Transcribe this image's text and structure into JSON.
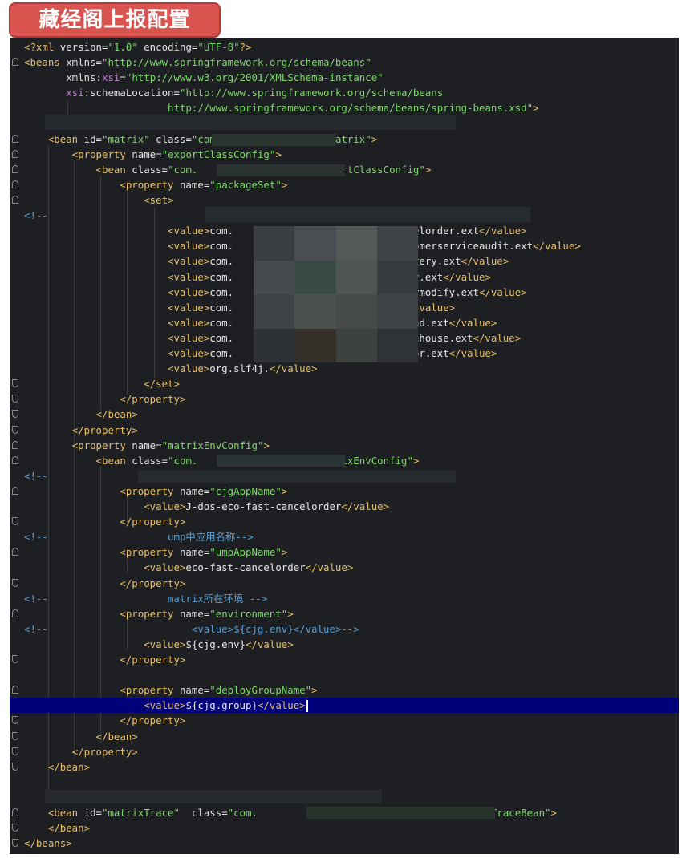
{
  "title": "藏经阁上报配置",
  "lines": [
    {
      "n": 1,
      "indent": "",
      "parts": [
        [
          "t",
          "<?xml "
        ],
        [
          "a",
          "version"
        ],
        [
          "v",
          "="
        ],
        [
          "s",
          "\"1.0\""
        ],
        [
          "a",
          " encoding"
        ],
        [
          "v",
          "="
        ],
        [
          "s",
          "\"UTF-8\""
        ],
        [
          "t",
          "?>"
        ]
      ]
    },
    {
      "n": 2,
      "parts": [
        [
          "t",
          "<beans "
        ],
        [
          "a",
          "xmlns"
        ],
        [
          "v",
          "="
        ],
        [
          "s",
          "\"http://www.springframework.org/schema/beans\""
        ]
      ]
    },
    {
      "n": 3,
      "parts": [
        [
          "v",
          "       "
        ],
        [
          "a",
          "xmlns"
        ],
        [
          "v",
          ":"
        ],
        [
          "ns",
          "xsi"
        ],
        [
          "v",
          "="
        ],
        [
          "s",
          "\"http://www.w3.org/2001/XMLSchema-instance\""
        ]
      ]
    },
    {
      "n": 4,
      "parts": [
        [
          "v",
          "       "
        ],
        [
          "ns",
          "xsi"
        ],
        [
          "v",
          ":"
        ],
        [
          "a",
          "schemaLocation"
        ],
        [
          "v",
          "="
        ],
        [
          "s",
          "\"http://www.springframework.org/schema/beans"
        ]
      ]
    },
    {
      "n": 5,
      "parts": [
        [
          "s",
          "                        http://www.springframework.org/schema/beans/spring-beans.xsd\""
        ],
        [
          "t",
          ">"
        ]
      ]
    },
    {
      "n": 6,
      "parts": []
    },
    {
      "n": 7,
      "parts": [
        [
          "v",
          "    "
        ],
        [
          "t",
          "<bean "
        ],
        [
          "a",
          "id"
        ],
        [
          "v",
          "="
        ],
        [
          "s",
          "\"matrix\""
        ],
        [
          "a",
          " class"
        ],
        [
          "v",
          "="
        ],
        [
          "s",
          "\"com.                  Matrix\""
        ],
        [
          "t",
          ">"
        ]
      ]
    },
    {
      "n": 8,
      "parts": [
        [
          "v",
          "        "
        ],
        [
          "t",
          "<property "
        ],
        [
          "a",
          "name"
        ],
        [
          "v",
          "="
        ],
        [
          "s",
          "\"exportClassConfig\""
        ],
        [
          "t",
          ">"
        ]
      ]
    },
    {
      "n": 9,
      "parts": [
        [
          "v",
          "            "
        ],
        [
          "t",
          "<bean "
        ],
        [
          "a",
          "class"
        ],
        [
          "v",
          "="
        ],
        [
          "s",
          "\"com.                    ExportClassConfig\""
        ],
        [
          "t",
          ">"
        ]
      ]
    },
    {
      "n": 10,
      "parts": [
        [
          "v",
          "                "
        ],
        [
          "t",
          "<property "
        ],
        [
          "a",
          "name"
        ],
        [
          "v",
          "="
        ],
        [
          "s",
          "\"packageSet\""
        ],
        [
          "t",
          ">"
        ]
      ]
    },
    {
      "n": 11,
      "parts": [
        [
          "v",
          "                    "
        ],
        [
          "t",
          "<set>"
        ]
      ]
    },
    {
      "n": 12,
      "parts": [
        [
          "c",
          "<!--"
        ]
      ]
    },
    {
      "n": 13,
      "parts": [
        [
          "v",
          "                        "
        ],
        [
          "t",
          "<value>"
        ],
        [
          "v",
          "com.                          cancelorder.ext"
        ],
        [
          "t",
          "</value>"
        ]
      ]
    },
    {
      "n": 14,
      "parts": [
        [
          "v",
          "                        "
        ],
        [
          "t",
          "<value>"
        ],
        [
          "v",
          "com.                          customerserviceaudit.ext"
        ],
        [
          "t",
          "</value>"
        ]
      ]
    },
    {
      "n": 15,
      "parts": [
        [
          "v",
          "                        "
        ],
        [
          "t",
          "<value>"
        ],
        [
          "v",
          "com.                          delivery.ext"
        ],
        [
          "t",
          "</value>"
        ]
      ]
    },
    {
      "n": 16,
      "parts": [
        [
          "v",
          "                        "
        ],
        [
          "t",
          "<value>"
        ],
        [
          "v",
          "com.                          order.ext"
        ],
        [
          "t",
          "</value>"
        ]
      ]
    },
    {
      "n": 17,
      "parts": [
        [
          "v",
          "                        "
        ],
        [
          "t",
          "<value>"
        ],
        [
          "v",
          "com.                          ordermodify.ext"
        ],
        [
          "t",
          "</value>"
        ]
      ]
    },
    {
      "n": 18,
      "parts": [
        [
          "v",
          "                        "
        ],
        [
          "t",
          "<value>"
        ],
        [
          "v",
          "com.                          ext"
        ],
        [
          "t",
          "</value>"
        ]
      ]
    },
    {
      "n": 19,
      "parts": [
        [
          "v",
          "                        "
        ],
        [
          "t",
          "<value>"
        ],
        [
          "v",
          "com.                          refund.ext"
        ],
        [
          "t",
          "</value>"
        ]
      ]
    },
    {
      "n": 20,
      "parts": [
        [
          "v",
          "                        "
        ],
        [
          "t",
          "<value>"
        ],
        [
          "v",
          "com.                          storehouse.ext"
        ],
        [
          "t",
          "</value>"
        ]
      ]
    },
    {
      "n": 21,
      "parts": [
        [
          "v",
          "                        "
        ],
        [
          "t",
          "<value>"
        ],
        [
          "v",
          "com.                          vendor.ext"
        ],
        [
          "t",
          "</value>"
        ]
      ]
    },
    {
      "n": 22,
      "parts": [
        [
          "v",
          "                        "
        ],
        [
          "t",
          "<value>"
        ],
        [
          "v",
          "org.slf4j."
        ],
        [
          "t",
          "</value>"
        ]
      ]
    },
    {
      "n": 23,
      "parts": [
        [
          "v",
          "                    "
        ],
        [
          "t",
          "</set>"
        ]
      ]
    },
    {
      "n": 24,
      "parts": [
        [
          "v",
          "                "
        ],
        [
          "t",
          "</property>"
        ]
      ]
    },
    {
      "n": 25,
      "parts": [
        [
          "v",
          "            "
        ],
        [
          "t",
          "</bean>"
        ]
      ]
    },
    {
      "n": 26,
      "parts": [
        [
          "v",
          "        "
        ],
        [
          "t",
          "</property>"
        ]
      ]
    },
    {
      "n": 27,
      "parts": [
        [
          "v",
          "        "
        ],
        [
          "t",
          "<property "
        ],
        [
          "a",
          "name"
        ],
        [
          "v",
          "="
        ],
        [
          "s",
          "\"matrixEnvConfig\""
        ],
        [
          "t",
          ">"
        ]
      ]
    },
    {
      "n": 28,
      "parts": [
        [
          "v",
          "            "
        ],
        [
          "t",
          "<bean "
        ],
        [
          "a",
          "class"
        ],
        [
          "v",
          "="
        ],
        [
          "s",
          "\"com.                    MatrixEnvConfig\""
        ],
        [
          "t",
          ">"
        ]
      ]
    },
    {
      "n": 29,
      "parts": [
        [
          "c",
          "<!--"
        ]
      ]
    },
    {
      "n": 30,
      "parts": [
        [
          "v",
          "                "
        ],
        [
          "t",
          "<property "
        ],
        [
          "a",
          "name"
        ],
        [
          "v",
          "="
        ],
        [
          "s",
          "\"cjgAppName\""
        ],
        [
          "t",
          ">"
        ]
      ]
    },
    {
      "n": 31,
      "parts": [
        [
          "v",
          "                    "
        ],
        [
          "t",
          "<value>"
        ],
        [
          "v",
          "J-dos-eco-fast-cancelorder"
        ],
        [
          "t",
          "</value>"
        ]
      ]
    },
    {
      "n": 32,
      "parts": [
        [
          "v",
          "                "
        ],
        [
          "t",
          "</property>"
        ]
      ]
    },
    {
      "n": 33,
      "parts": [
        [
          "c",
          "<!--                    ump中应用名称-->"
        ]
      ]
    },
    {
      "n": 34,
      "parts": [
        [
          "v",
          "                "
        ],
        [
          "t",
          "<property "
        ],
        [
          "a",
          "name"
        ],
        [
          "v",
          "="
        ],
        [
          "s",
          "\"umpAppName\""
        ],
        [
          "t",
          ">"
        ]
      ]
    },
    {
      "n": 35,
      "parts": [
        [
          "v",
          "                    "
        ],
        [
          "t",
          "<value>"
        ],
        [
          "v",
          "eco-fast-cancelorder"
        ],
        [
          "t",
          "</value>"
        ]
      ]
    },
    {
      "n": 36,
      "parts": [
        [
          "v",
          "                "
        ],
        [
          "t",
          "</property>"
        ]
      ]
    },
    {
      "n": 37,
      "parts": [
        [
          "c",
          "<!--                    matrix所在环境 -->"
        ]
      ]
    },
    {
      "n": 38,
      "parts": [
        [
          "v",
          "                "
        ],
        [
          "t",
          "<property "
        ],
        [
          "a",
          "name"
        ],
        [
          "v",
          "="
        ],
        [
          "s",
          "\"environment\""
        ],
        [
          "t",
          ">"
        ]
      ]
    },
    {
      "n": 39,
      "parts": [
        [
          "c",
          "<!--                        <value>${cjg.env}</value>-->"
        ]
      ]
    },
    {
      "n": 40,
      "parts": [
        [
          "v",
          "                    "
        ],
        [
          "t",
          "<value>"
        ],
        [
          "v",
          "${cjg.env}"
        ],
        [
          "t",
          "</value>"
        ]
      ]
    },
    {
      "n": 41,
      "parts": [
        [
          "v",
          "                "
        ],
        [
          "t",
          "</property>"
        ]
      ]
    },
    {
      "n": 42,
      "parts": []
    },
    {
      "n": 43,
      "parts": [
        [
          "v",
          "                "
        ],
        [
          "t",
          "<property "
        ],
        [
          "a",
          "name"
        ],
        [
          "v",
          "="
        ],
        [
          "s",
          "\"deployGroupName\""
        ],
        [
          "t",
          ">"
        ]
      ]
    },
    {
      "n": 44,
      "parts": [
        [
          "v",
          "                    "
        ],
        [
          "t",
          "<value>"
        ],
        [
          "v",
          "${cjg.group}"
        ],
        [
          "t",
          "</value>"
        ]
      ]
    },
    {
      "n": 45,
      "parts": [
        [
          "v",
          "                "
        ],
        [
          "t",
          "</property>"
        ]
      ]
    },
    {
      "n": 46,
      "parts": [
        [
          "v",
          "            "
        ],
        [
          "t",
          "</bean>"
        ]
      ]
    },
    {
      "n": 47,
      "parts": [
        [
          "v",
          "        "
        ],
        [
          "t",
          "</property>"
        ]
      ]
    },
    {
      "n": 48,
      "parts": [
        [
          "v",
          "    "
        ],
        [
          "t",
          "</bean>"
        ]
      ]
    },
    {
      "n": 49,
      "parts": []
    },
    {
      "n": 50,
      "parts": []
    },
    {
      "n": 51,
      "parts": [
        [
          "v",
          "    "
        ],
        [
          "t",
          "<bean "
        ],
        [
          "a",
          "id"
        ],
        [
          "v",
          "="
        ],
        [
          "s",
          "\"matrixTrace\""
        ],
        [
          "a",
          "  class"
        ],
        [
          "v",
          "="
        ],
        [
          "s",
          "\"com.                                .MatrixTraceBean\""
        ],
        [
          "t",
          ">"
        ]
      ]
    },
    {
      "n": 52,
      "parts": [
        [
          "v",
          "    "
        ],
        [
          "t",
          "</bean>"
        ]
      ]
    },
    {
      "n": 53,
      "parts": [
        [
          "t",
          "</beans>"
        ]
      ]
    }
  ],
  "highlight_line": 44,
  "fold_markers": {
    "start": [
      2,
      7,
      8,
      9,
      10,
      11,
      27,
      28,
      30,
      34,
      38,
      43,
      51
    ],
    "end": [
      23,
      24,
      25,
      26,
      32,
      36,
      41,
      45,
      46,
      47,
      48,
      52,
      53
    ],
    "comment": [
      12,
      29,
      33,
      37,
      39
    ]
  }
}
